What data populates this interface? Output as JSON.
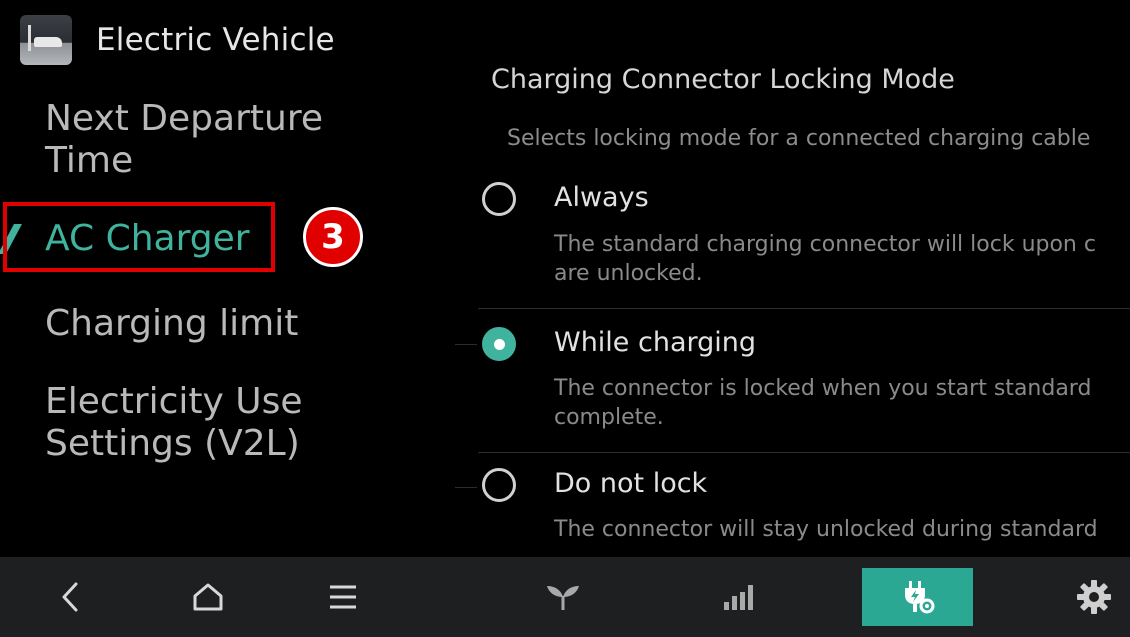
{
  "header": {
    "title": "Electric Vehicle",
    "app_icon": "ev-app-thumbnail-icon"
  },
  "sidebar": {
    "items": [
      {
        "label": "Next Departure\nTime",
        "active": false
      },
      {
        "label": "AC Charger",
        "active": true
      },
      {
        "label": "Charging limit",
        "active": false
      },
      {
        "label": "Electricity Use\nSettings (V2L)",
        "active": false
      }
    ],
    "active_color": "#3fb39d"
  },
  "annotation": {
    "step_number": "3",
    "highlight_color": "#e00000"
  },
  "main": {
    "section_title": "Charging Connector Locking Mode",
    "section_description": "Selects locking mode for a connected charging cable",
    "options": [
      {
        "label": "Always",
        "description": "The standard charging connector will lock upon c\nare unlocked.",
        "selected": false
      },
      {
        "label": "While charging",
        "description": "The connector is locked when you start standard\ncomplete.",
        "selected": true
      },
      {
        "label": "Do not lock",
        "description": "The connector will stay unlocked during standard",
        "selected": false
      }
    ]
  },
  "bottom_bar": {
    "buttons": [
      {
        "icon": "back-chevron-icon"
      },
      {
        "icon": "home-icon"
      },
      {
        "icon": "menu-icon"
      },
      {
        "icon": "eco-sprout-icon"
      },
      {
        "icon": "energy-bars-icon"
      },
      {
        "icon": "charging-settings-icon",
        "active": true
      },
      {
        "icon": "gear-icon"
      }
    ],
    "active_color": "#2aa893"
  }
}
